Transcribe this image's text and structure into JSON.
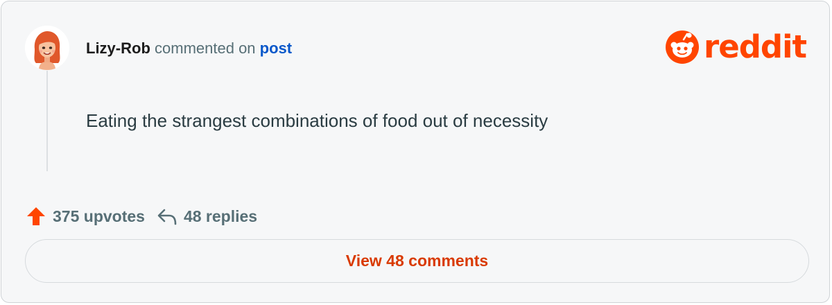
{
  "comment": {
    "username": "Lizy-Rob",
    "action_text": "commented on",
    "post_link_label": "post",
    "body": "Eating the strangest combinations of food out of necessity"
  },
  "brand": {
    "wordmark": "reddit",
    "color": "#ff4500"
  },
  "stats": {
    "upvotes_label": "375 upvotes",
    "replies_label": "48 replies",
    "upvote_icon": "upvote-arrow-icon",
    "reply_icon": "reply-arrow-icon"
  },
  "footer": {
    "view_comments_label": "View 48 comments"
  },
  "colors": {
    "username": "#1c1c1c",
    "link": "#0a58ca",
    "button_text": "#d93a00",
    "muted": "#576f76"
  }
}
